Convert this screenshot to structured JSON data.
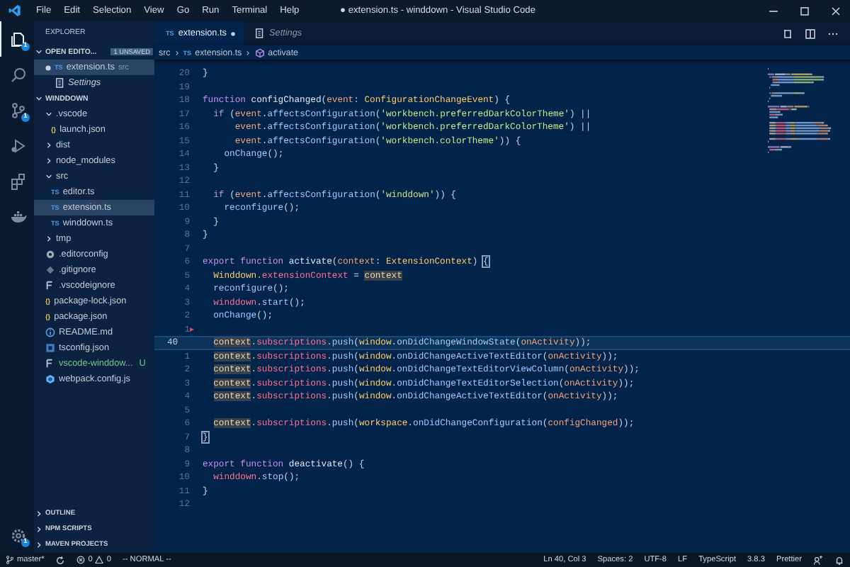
{
  "title_bar": {
    "menus": [
      "File",
      "Edit",
      "Selection",
      "View",
      "Go",
      "Run",
      "Terminal",
      "Help"
    ],
    "title": "● extension.ts - winddown - Visual Studio Code"
  },
  "activity_bar": {
    "items": [
      {
        "kind": "files",
        "badge": "1",
        "selected": true
      },
      {
        "kind": "search",
        "selected": false
      },
      {
        "kind": "source-control",
        "badge": "1",
        "selected": false
      },
      {
        "kind": "debug",
        "selected": false
      },
      {
        "kind": "extensions",
        "selected": false
      },
      {
        "kind": "docker",
        "selected": false
      }
    ],
    "manage": {
      "kind": "gear",
      "badge": "1"
    }
  },
  "explorer": {
    "title": "EXPLORER",
    "open_editors": {
      "title": "OPEN EDITO...",
      "badge": "1 UNSAVED",
      "expanded": true,
      "items": [
        {
          "label": "extension.ts",
          "kind": "ts",
          "tag": "TS",
          "description": "src",
          "dirty": true,
          "preview": false,
          "selected": true
        },
        {
          "label": "Settings",
          "kind": "settings",
          "dirty": false,
          "preview": true,
          "selected": false
        }
      ]
    },
    "project": {
      "title": "WINDDOWN",
      "expanded": true,
      "items": [
        {
          "label": ".vscode",
          "kind": "folder",
          "expanded": true,
          "selected": false,
          "children": [
            {
              "label": "launch.json",
              "kind": "json",
              "tag": "{}",
              "selected": false
            }
          ]
        },
        {
          "label": "dist",
          "kind": "folder",
          "expanded": false,
          "selected": false
        },
        {
          "label": "node_modules",
          "kind": "folder",
          "expanded": false,
          "selected": false
        },
        {
          "label": "src",
          "kind": "folder",
          "expanded": true,
          "selected": false,
          "children": [
            {
              "label": "editor.ts",
              "kind": "ts",
              "tag": "TS",
              "selected": false
            },
            {
              "label": "extension.ts",
              "kind": "ts",
              "tag": "TS",
              "selected": true
            },
            {
              "label": "winddown.ts",
              "kind": "ts",
              "tag": "TS",
              "selected": false
            }
          ]
        },
        {
          "label": "tmp",
          "kind": "folder",
          "expanded": false,
          "selected": false
        },
        {
          "label": ".editorconfig",
          "kind": "gear",
          "selected": false
        },
        {
          "label": ".gitignore",
          "kind": "git",
          "selected": false
        },
        {
          "label": ".vscodeignore",
          "kind": "lines",
          "selected": false
        },
        {
          "label": "package-lock.json",
          "kind": "json",
          "tag": "{}",
          "selected": false
        },
        {
          "label": "package.json",
          "kind": "json",
          "tag": "{}",
          "selected": false
        },
        {
          "label": "README.md",
          "kind": "info",
          "selected": false
        },
        {
          "label": "tsconfig.json",
          "kind": "tsconfig",
          "selected": false
        },
        {
          "label": "vscode-winddow...",
          "kind": "lines",
          "git_status": "U",
          "selected": false
        },
        {
          "label": "webpack.config.js",
          "kind": "webpack",
          "selected": false
        }
      ]
    },
    "collapsed_sections": [
      {
        "title": "OUTLINE",
        "expanded": false
      },
      {
        "title": "NPM SCRIPTS",
        "expanded": false
      },
      {
        "title": "MAVEN PROJECTS",
        "expanded": false
      }
    ]
  },
  "tabs": [
    {
      "label": "extension.ts",
      "kind": "ts",
      "tag": "TS",
      "dirty": true,
      "preview": false,
      "selected": true
    },
    {
      "label": "Settings",
      "kind": "settings",
      "dirty": false,
      "preview": true,
      "selected": false
    }
  ],
  "breadcrumb": [
    {
      "label": "src",
      "kind": "folder"
    },
    {
      "label": "extension.ts",
      "kind": "ts",
      "tag": "TS"
    },
    {
      "label": "activate",
      "kind": "method"
    }
  ],
  "editor": {
    "lines": [
      {
        "number": "20",
        "tokens": [
          {
            "kind": "plain",
            "text": "}"
          }
        ]
      },
      {
        "number": "19"
      },
      {
        "number": "18",
        "tokens": [
          {
            "kind": "kw",
            "text": "function "
          },
          {
            "kind": "fn",
            "text": "configChanged"
          },
          {
            "kind": "plain",
            "text": "("
          },
          {
            "kind": "param",
            "text": "event"
          },
          {
            "kind": "plain",
            "text": ": "
          },
          {
            "kind": "type",
            "text": "ConfigurationChangeEvent"
          },
          {
            "kind": "plain",
            "text": ") {"
          }
        ]
      },
      {
        "number": "17",
        "tokens": [
          {
            "kind": "kw",
            "text": "  if"
          },
          {
            "kind": "plain",
            "text": " ("
          },
          {
            "kind": "param",
            "text": "event"
          },
          {
            "kind": "plain",
            "text": "."
          },
          {
            "kind": "call",
            "text": "affectsConfiguration"
          },
          {
            "kind": "plain",
            "text": "("
          },
          {
            "kind": "str",
            "text": "'workbench.preferredDarkColorTheme'"
          },
          {
            "kind": "plain",
            "text": ") ||"
          }
        ]
      },
      {
        "number": "16",
        "tokens": [
          {
            "kind": "param",
            "text": "      event"
          },
          {
            "kind": "plain",
            "text": "."
          },
          {
            "kind": "call",
            "text": "affectsConfiguration"
          },
          {
            "kind": "plain",
            "text": "("
          },
          {
            "kind": "str",
            "text": "'workbench.preferredDarkColorTheme'"
          },
          {
            "kind": "plain",
            "text": ") ||"
          }
        ]
      },
      {
        "number": "15",
        "tokens": [
          {
            "kind": "param",
            "text": "      event"
          },
          {
            "kind": "plain",
            "text": "."
          },
          {
            "kind": "call",
            "text": "affectsConfiguration"
          },
          {
            "kind": "plain",
            "text": "("
          },
          {
            "kind": "str",
            "text": "'workbench.colorTheme'"
          },
          {
            "kind": "plain",
            "text": ")) {"
          }
        ]
      },
      {
        "number": "14",
        "tokens": [
          {
            "kind": "call",
            "text": "    onChange"
          },
          {
            "kind": "plain",
            "text": "();"
          }
        ]
      },
      {
        "number": "13",
        "tokens": [
          {
            "kind": "plain",
            "text": "  }"
          }
        ]
      },
      {
        "number": "12"
      },
      {
        "number": "11",
        "tokens": [
          {
            "kind": "kw",
            "text": "  if"
          },
          {
            "kind": "plain",
            "text": " ("
          },
          {
            "kind": "param",
            "text": "event"
          },
          {
            "kind": "plain",
            "text": "."
          },
          {
            "kind": "call",
            "text": "affectsConfiguration"
          },
          {
            "kind": "plain",
            "text": "("
          },
          {
            "kind": "str",
            "text": "'winddown'"
          },
          {
            "kind": "plain",
            "text": ")) {"
          }
        ]
      },
      {
        "number": "10",
        "tokens": [
          {
            "kind": "call",
            "text": "    reconfigure"
          },
          {
            "kind": "plain",
            "text": "();"
          }
        ]
      },
      {
        "number": "9",
        "tokens": [
          {
            "kind": "plain",
            "text": "  }"
          }
        ]
      },
      {
        "number": "8",
        "tokens": [
          {
            "kind": "plain",
            "text": "}"
          }
        ]
      },
      {
        "number": "7"
      },
      {
        "number": "6",
        "tokens": [
          {
            "kind": "kw",
            "text": "export function "
          },
          {
            "kind": "fn",
            "text": "activate"
          },
          {
            "kind": "plain",
            "text": "("
          },
          {
            "kind": "param",
            "text": "context"
          },
          {
            "kind": "plain",
            "text": ": "
          },
          {
            "kind": "type",
            "text": "ExtensionContext"
          },
          {
            "kind": "plain",
            "text": ") "
          },
          {
            "kind": "bracket",
            "text": "{"
          }
        ]
      },
      {
        "number": "5",
        "tokens": [
          {
            "kind": "type",
            "text": "  Winddown"
          },
          {
            "kind": "plain",
            "text": "."
          },
          {
            "kind": "var",
            "text": "extensionContext"
          },
          {
            "kind": "plain",
            "text": " = "
          },
          {
            "kind": "hl",
            "text": "context"
          }
        ]
      },
      {
        "number": "4",
        "tokens": [
          {
            "kind": "call",
            "text": "  reconfigure"
          },
          {
            "kind": "plain",
            "text": "();"
          }
        ]
      },
      {
        "number": "3",
        "tokens": [
          {
            "kind": "var",
            "text": "  winddown"
          },
          {
            "kind": "plain",
            "text": "."
          },
          {
            "kind": "call",
            "text": "start"
          },
          {
            "kind": "plain",
            "text": "();"
          }
        ]
      },
      {
        "number": "2",
        "tokens": [
          {
            "kind": "call",
            "text": "  onChange"
          },
          {
            "kind": "plain",
            "text": "();"
          }
        ]
      },
      {
        "number": "1",
        "marker": true
      },
      {
        "number": "40",
        "current": true,
        "tokens": [
          {
            "kind": "hl",
            "text": "  context"
          },
          {
            "kind": "plain",
            "text": "."
          },
          {
            "kind": "var",
            "text": "subscriptions"
          },
          {
            "kind": "plain",
            "text": "."
          },
          {
            "kind": "call",
            "text": "push"
          },
          {
            "kind": "plain",
            "text": "("
          },
          {
            "kind": "type",
            "text": "window"
          },
          {
            "kind": "plain",
            "text": "."
          },
          {
            "kind": "call",
            "text": "onDidChangeWindowState"
          },
          {
            "kind": "plain",
            "text": "("
          },
          {
            "kind": "param",
            "text": "onActivity"
          },
          {
            "kind": "plain",
            "text": "));"
          }
        ]
      },
      {
        "number": "1",
        "tokens": [
          {
            "kind": "hl",
            "text": "  context"
          },
          {
            "kind": "plain",
            "text": "."
          },
          {
            "kind": "var",
            "text": "subscriptions"
          },
          {
            "kind": "plain",
            "text": "."
          },
          {
            "kind": "call",
            "text": "push"
          },
          {
            "kind": "plain",
            "text": "("
          },
          {
            "kind": "type",
            "text": "window"
          },
          {
            "kind": "plain",
            "text": "."
          },
          {
            "kind": "call",
            "text": "onDidChangeActiveTextEditor"
          },
          {
            "kind": "plain",
            "text": "("
          },
          {
            "kind": "param",
            "text": "onActivity"
          },
          {
            "kind": "plain",
            "text": "));"
          }
        ]
      },
      {
        "number": "2",
        "tokens": [
          {
            "kind": "hl",
            "text": "  context"
          },
          {
            "kind": "plain",
            "text": "."
          },
          {
            "kind": "var",
            "text": "subscriptions"
          },
          {
            "kind": "plain",
            "text": "."
          },
          {
            "kind": "call",
            "text": "push"
          },
          {
            "kind": "plain",
            "text": "("
          },
          {
            "kind": "type",
            "text": "window"
          },
          {
            "kind": "plain",
            "text": "."
          },
          {
            "kind": "call",
            "text": "onDidChangeTextEditorViewColumn"
          },
          {
            "kind": "plain",
            "text": "("
          },
          {
            "kind": "param",
            "text": "onActivity"
          },
          {
            "kind": "plain",
            "text": "));"
          }
        ]
      },
      {
        "number": "3",
        "tokens": [
          {
            "kind": "hl",
            "text": "  context"
          },
          {
            "kind": "plain",
            "text": "."
          },
          {
            "kind": "var",
            "text": "subscriptions"
          },
          {
            "kind": "plain",
            "text": "."
          },
          {
            "kind": "call",
            "text": "push"
          },
          {
            "kind": "plain",
            "text": "("
          },
          {
            "kind": "type",
            "text": "window"
          },
          {
            "kind": "plain",
            "text": "."
          },
          {
            "kind": "call",
            "text": "onDidChangeTextEditorSelection"
          },
          {
            "kind": "plain",
            "text": "("
          },
          {
            "kind": "param",
            "text": "onActivity"
          },
          {
            "kind": "plain",
            "text": "));"
          }
        ]
      },
      {
        "number": "4",
        "tokens": [
          {
            "kind": "hl",
            "text": "  context"
          },
          {
            "kind": "plain",
            "text": "."
          },
          {
            "kind": "var",
            "text": "subscriptions"
          },
          {
            "kind": "plain",
            "text": "."
          },
          {
            "kind": "call",
            "text": "push"
          },
          {
            "kind": "plain",
            "text": "("
          },
          {
            "kind": "type",
            "text": "window"
          },
          {
            "kind": "plain",
            "text": "."
          },
          {
            "kind": "call",
            "text": "onDidChangeActiveTextEditor"
          },
          {
            "kind": "plain",
            "text": "("
          },
          {
            "kind": "param",
            "text": "onActivity"
          },
          {
            "kind": "plain",
            "text": "));"
          }
        ]
      },
      {
        "number": "5"
      },
      {
        "number": "6",
        "tokens": [
          {
            "kind": "hl",
            "text": "  context"
          },
          {
            "kind": "plain",
            "text": "."
          },
          {
            "kind": "var",
            "text": "subscriptions"
          },
          {
            "kind": "plain",
            "text": "."
          },
          {
            "kind": "call",
            "text": "push"
          },
          {
            "kind": "plain",
            "text": "("
          },
          {
            "kind": "type",
            "text": "workspace"
          },
          {
            "kind": "plain",
            "text": "."
          },
          {
            "kind": "call",
            "text": "onDidChangeConfiguration"
          },
          {
            "kind": "plain",
            "text": "("
          },
          {
            "kind": "param",
            "text": "configChanged"
          },
          {
            "kind": "plain",
            "text": "));"
          }
        ]
      },
      {
        "number": "7",
        "tokens": [
          {
            "kind": "bracket",
            "text": "}"
          }
        ]
      },
      {
        "number": "8"
      },
      {
        "number": "9",
        "tokens": [
          {
            "kind": "kw",
            "text": "export function "
          },
          {
            "kind": "fn",
            "text": "deactivate"
          },
          {
            "kind": "plain",
            "text": "() {"
          }
        ]
      },
      {
        "number": "10",
        "tokens": [
          {
            "kind": "var",
            "text": "  winddown"
          },
          {
            "kind": "plain",
            "text": "."
          },
          {
            "kind": "call",
            "text": "stop"
          },
          {
            "kind": "plain",
            "text": "();"
          }
        ]
      },
      {
        "number": "11",
        "tokens": [
          {
            "kind": "plain",
            "text": "}"
          }
        ]
      },
      {
        "number": "12"
      }
    ]
  },
  "status_bar": {
    "branch": "master*",
    "errors": "0",
    "warnings": "0",
    "mode": "-- NORMAL --",
    "right_items": [
      "Ln 40, Col 3",
      "Spaces: 2",
      "UTF-8",
      "LF",
      "TypeScript",
      "3.8.3",
      "Prettier"
    ]
  }
}
